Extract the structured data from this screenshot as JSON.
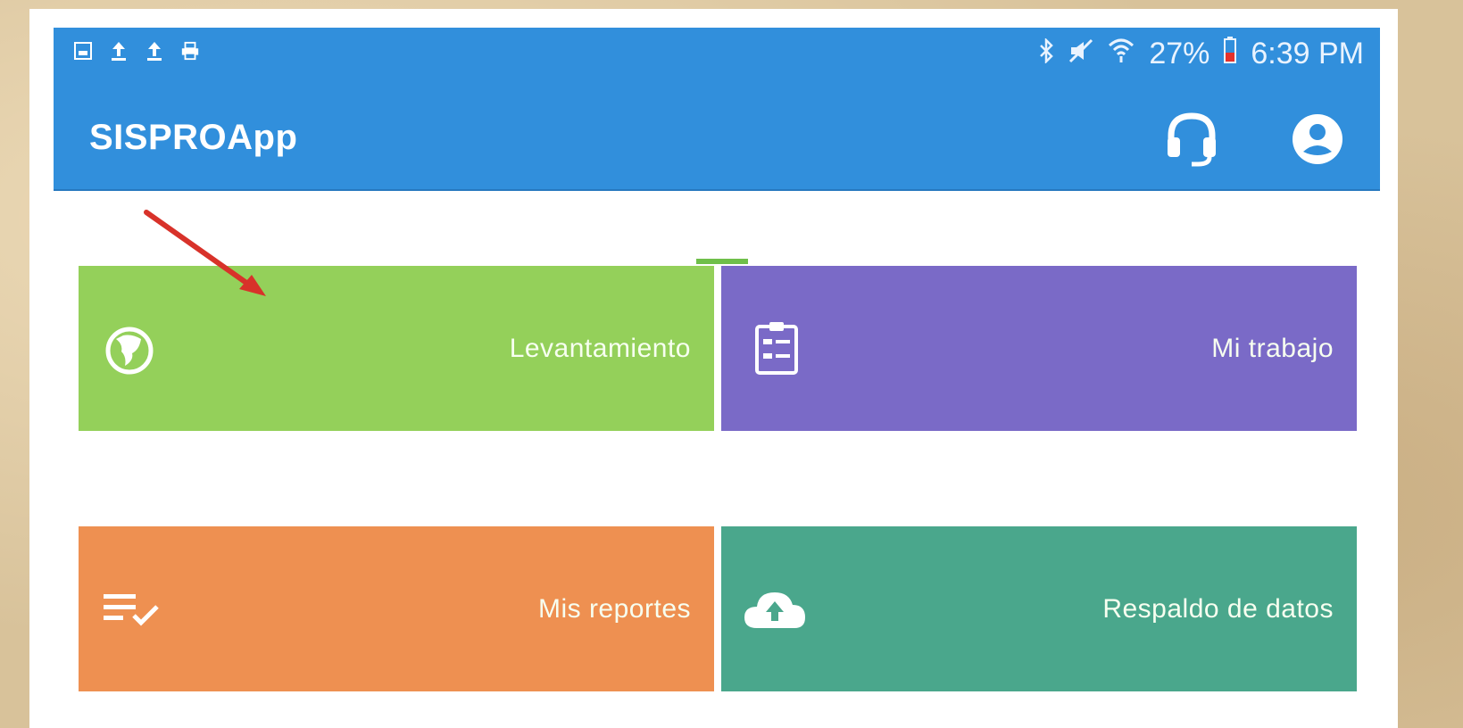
{
  "statusbar": {
    "battery": "27%",
    "time": "6:39 PM",
    "left_icons": [
      "gallery-icon",
      "upload-icon",
      "upload-icon",
      "printer-icon"
    ],
    "right_icons": [
      "bluetooth-icon",
      "mute-icon",
      "wifi-icon",
      "battery-icon"
    ]
  },
  "appbar": {
    "title": "SISPROApp",
    "actions": [
      "headset-icon",
      "account-icon"
    ]
  },
  "tiles": [
    {
      "label": "Levantamiento",
      "icon": "globe-icon",
      "color": "#94d05a"
    },
    {
      "label": "Mi trabajo",
      "icon": "clipboard-icon",
      "color": "#7a6ac7"
    },
    {
      "label": "Mis reportes",
      "icon": "checklist-icon",
      "color": "#ee9051"
    },
    {
      "label": "Respaldo de datos",
      "icon": "cloud-upload-icon",
      "color": "#4aa78c"
    }
  ],
  "colors": {
    "primary": "#318fdc",
    "annotation_arrow": "#d8322a"
  }
}
